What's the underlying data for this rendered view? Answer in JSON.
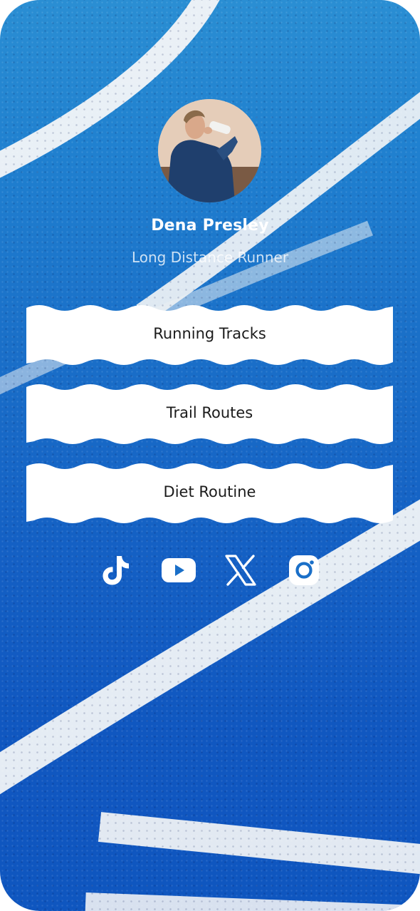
{
  "profile": {
    "name": "Dena Presley",
    "role": "Long Distance Runner"
  },
  "links": [
    {
      "label": "Running Tracks"
    },
    {
      "label": "Trail Routes"
    },
    {
      "label": "Diet Routine"
    }
  ],
  "socials": [
    {
      "icon": "tiktok-icon"
    },
    {
      "icon": "youtube-icon"
    },
    {
      "icon": "x-icon"
    },
    {
      "icon": "instagram-icon"
    }
  ],
  "colors": {
    "track_blue": "#1a6fc8",
    "lane_white": "#f2f4f6",
    "card_white": "#ffffff",
    "text_dark": "#1b1b1b"
  }
}
